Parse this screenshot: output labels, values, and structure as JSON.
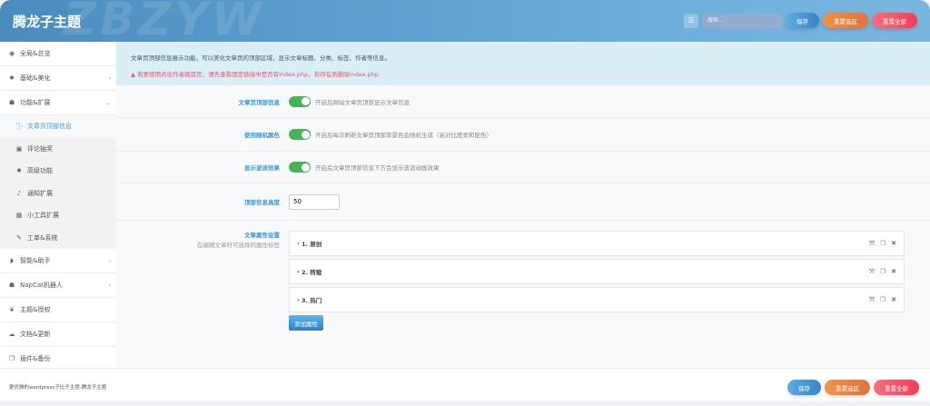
{
  "header": {
    "title": "腾龙子主题",
    "watermark": "ZBZYW",
    "search_placeholder": "搜索...",
    "save": "保存",
    "reset_section": "重置选区",
    "reset_all": "重置全部"
  },
  "sidebar": {
    "items": [
      {
        "label": "全局&总览",
        "icon": "globe-icon"
      },
      {
        "label": "基础&美化",
        "icon": "gear-icon",
        "chevron": "›"
      },
      {
        "label": "功能&扩展",
        "icon": "cubes-icon",
        "chevron": "⌄"
      },
      {
        "label": "文章页顶部信息",
        "icon": "info-icon",
        "sub": true,
        "active": true
      },
      {
        "label": "评论抽奖",
        "icon": "gift-icon",
        "sub": true
      },
      {
        "label": "高级功能",
        "icon": "gear-icon",
        "sub": true
      },
      {
        "label": "通知扩展",
        "icon": "bell-icon",
        "sub": true
      },
      {
        "label": "小工具扩展",
        "icon": "grid-icon",
        "sub": true
      },
      {
        "label": "工单&系统",
        "icon": "tools-icon",
        "sub": true
      },
      {
        "label": "智能&助手",
        "icon": "shield-icon",
        "chevron": "›"
      },
      {
        "label": "NapCat机器人",
        "icon": "bot-icon",
        "chevron": "›"
      },
      {
        "label": "主题&授权",
        "icon": "key-icon"
      },
      {
        "label": "文档&更新",
        "icon": "cloud-icon"
      },
      {
        "label": "插件&备份",
        "icon": "copy-icon"
      }
    ]
  },
  "notice": {
    "info": "文章页顶部信息展示功能，可以美化文章页的顶部区域，显示文章标题、分类、标签、作者等信息。",
    "warning": "若要使用点击作者跳首页，请先查看固定链接中是否有index.php，若存在则删除index.php"
  },
  "settings": {
    "show_top": {
      "label": "文章页顶部信息",
      "desc": "开启后网站文章页顶部显示文章信息",
      "on": true
    },
    "random_color": {
      "label": "使用随机颜色",
      "desc": "开启后每次刷新文章页顶部背景色会随机生成（高对比度柔和配色）",
      "on": true
    },
    "wave": {
      "label": "显示波浪效果",
      "desc": "开启后文章页顶部信息下方会显示波浪动画效果",
      "on": true
    },
    "height": {
      "label": "顶部信息高度",
      "value": "50"
    },
    "attrs": {
      "label": "文章属性设置",
      "sub": "在编辑文章时可选择的属性标签",
      "items": [
        "1. 原创",
        "2. 转载",
        "3. 热门"
      ],
      "add": "添加属性"
    }
  },
  "footer": {
    "text": "更优雅的wordpress子比子主题-腾龙子主题",
    "save": "保存",
    "reset_section": "重置选区",
    "reset_all": "重置全部"
  }
}
